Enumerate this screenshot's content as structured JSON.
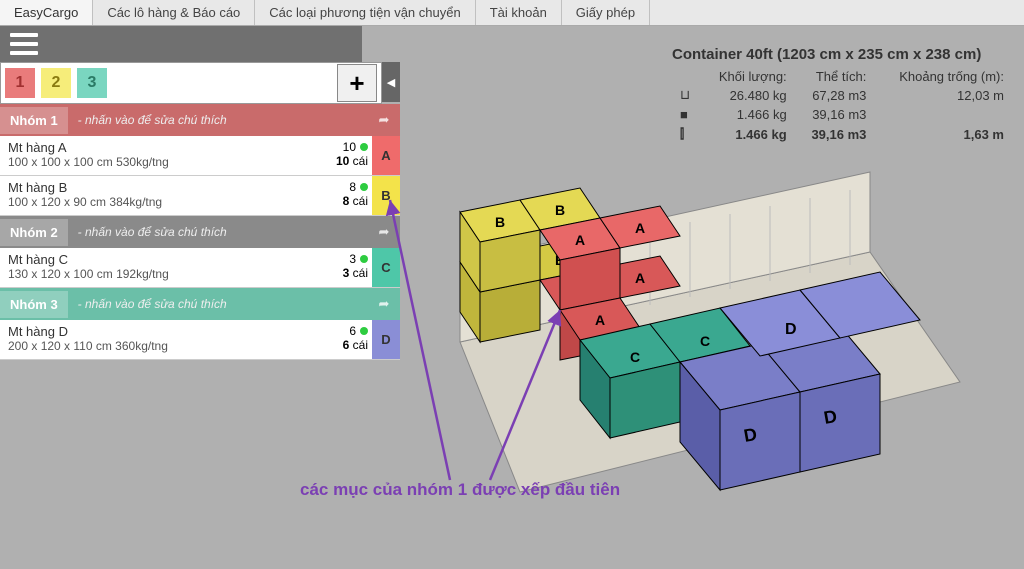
{
  "topnav": {
    "app": "EasyCargo",
    "tabs": [
      "Các lô hàng & Báo cáo",
      "Các loại phương tiện vận chuyển",
      "Tài khoản",
      "Giấy phép"
    ]
  },
  "num_tabs": [
    "1",
    "2",
    "3"
  ],
  "plus": "+",
  "collapse": "◀",
  "groups": [
    {
      "name": "Nhóm 1",
      "hint": "- nhấn vào để sửa chú thích",
      "hclass": "gh1",
      "items": [
        {
          "title": "Mt hàng A",
          "dims": "100 x 100 x 100 cm 530kg/tng",
          "req": "10",
          "loaded": "10",
          "unit": "cái",
          "label": "A"
        },
        {
          "title": "Mt hàng B",
          "dims": "100 x 120 x 90 cm 384kg/tng",
          "req": "8",
          "loaded": "8",
          "unit": "cái",
          "label": "B"
        }
      ]
    },
    {
      "name": "Nhóm 2",
      "hint": "- nhấn vào để sửa chú thích",
      "hclass": "gh2",
      "items": [
        {
          "title": "Mt hàng C",
          "dims": "130 x 120 x 100 cm 192kg/tng",
          "req": "3",
          "loaded": "3",
          "unit": "cái",
          "label": "C"
        }
      ]
    },
    {
      "name": "Nhóm 3",
      "hint": "- nhấn vào để sửa chú thích",
      "hclass": "gh3",
      "items": [
        {
          "title": "Mt hàng D",
          "dims": "200 x 120 x 110 cm 360kg/tng",
          "req": "6",
          "loaded": "6",
          "unit": "cái",
          "label": "D"
        }
      ]
    }
  ],
  "container": {
    "title": "Container 40ft (1203 cm x 235 cm x 238 cm)",
    "headers": {
      "mass": "Khối lượng:",
      "vol": "Thể tích:",
      "space": "Khoảng trống (m):"
    },
    "rows": [
      {
        "icon": "⊔",
        "mass": "26.480 kg",
        "vol": "67,28 m3",
        "space": "12,03 m",
        "bold": false
      },
      {
        "icon": "■",
        "mass": "1.466 kg",
        "vol": "39,16 m3",
        "space": "",
        "bold": false
      },
      {
        "icon": "⫿",
        "mass": "1.466 kg",
        "vol": "39,16 m3",
        "space": "1,63 m",
        "bold": true
      }
    ]
  },
  "annotation": "các mục của nhóm 1 được xếp đầu tiên"
}
